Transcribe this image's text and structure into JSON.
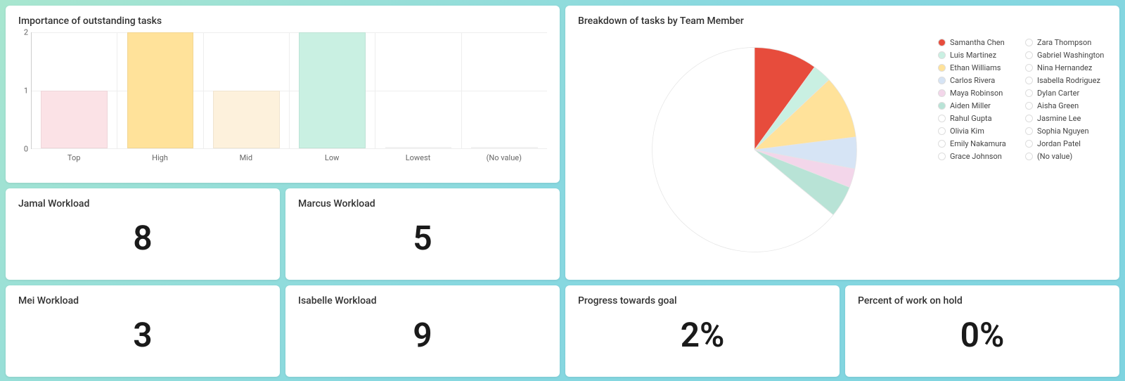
{
  "chart_data": [
    {
      "type": "bar",
      "title": "Importance of outstanding tasks",
      "categories": [
        "Top",
        "High",
        "Mid",
        "Low",
        "Lowest",
        "(No value)"
      ],
      "values": [
        1,
        2,
        1,
        2,
        0,
        0
      ],
      "colors": [
        "#fbe2e6",
        "#ffe29a",
        "#fdf1dc",
        "#c9f0e2",
        "#ffffff",
        "#ffffff"
      ],
      "ylim": [
        0,
        2
      ],
      "yticks": [
        0,
        1,
        2
      ]
    },
    {
      "type": "pie",
      "title": "Breakdown of tasks by Team Member",
      "series": [
        {
          "name": "Samantha Chen",
          "value": 10,
          "color": "#e74c3c"
        },
        {
          "name": "Luis Martinez",
          "value": 3,
          "color": "#c9f0e2"
        },
        {
          "name": "Ethan Williams",
          "value": 10,
          "color": "#ffe29a"
        },
        {
          "name": "Carlos Rivera",
          "value": 5,
          "color": "#d6e4f5"
        },
        {
          "name": "Maya Robinson",
          "value": 3,
          "color": "#f3d6ea"
        },
        {
          "name": "Aiden Miller",
          "value": 5,
          "color": "#b8e3d6"
        },
        {
          "name": "Rahul Gupta",
          "value": 0,
          "color": "#ffffff"
        },
        {
          "name": "Olivia Kim",
          "value": 0,
          "color": "#ffffff"
        },
        {
          "name": "Emily Nakamura",
          "value": 0,
          "color": "#ffffff"
        },
        {
          "name": "Grace Johnson",
          "value": 0,
          "color": "#ffffff"
        },
        {
          "name": "Zara Thompson",
          "value": 0,
          "color": "#ffffff"
        },
        {
          "name": "Gabriel Washington",
          "value": 0,
          "color": "#ffffff"
        },
        {
          "name": "Nina Hernandez",
          "value": 0,
          "color": "#ffffff"
        },
        {
          "name": "Isabella Rodriguez",
          "value": 0,
          "color": "#ffffff"
        },
        {
          "name": "Dylan Carter",
          "value": 0,
          "color": "#ffffff"
        },
        {
          "name": "Aisha Green",
          "value": 0,
          "color": "#ffffff"
        },
        {
          "name": "Jasmine Lee",
          "value": 0,
          "color": "#ffffff"
        },
        {
          "name": "Sophia Nguyen",
          "value": 0,
          "color": "#ffffff"
        },
        {
          "name": "Jordan Patel",
          "value": 0,
          "color": "#ffffff"
        },
        {
          "name": "(No value)",
          "value": 64,
          "color": "#ffffff"
        }
      ]
    }
  ],
  "workloads": [
    {
      "title": "Jamal Workload",
      "value": "8"
    },
    {
      "title": "Marcus Workload",
      "value": "5"
    },
    {
      "title": "Mei Workload",
      "value": "3"
    },
    {
      "title": "Isabelle Workload",
      "value": "9"
    }
  ],
  "progress": {
    "title": "Progress towards goal",
    "value": "2%"
  },
  "hold": {
    "title": "Percent of work on hold",
    "value": "0%"
  }
}
